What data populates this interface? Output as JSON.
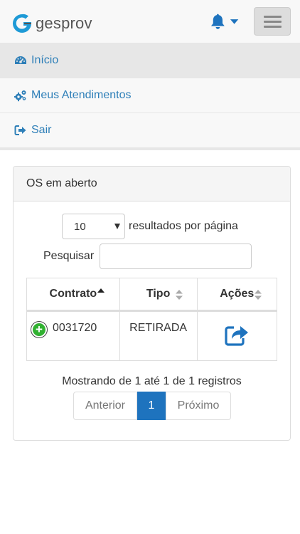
{
  "brand": {
    "logo_text": "gesprov",
    "accent": "#1e9ad6"
  },
  "header": {
    "bell_icon": "bell-icon",
    "menu_icon": "hamburger-icon"
  },
  "nav": {
    "items": [
      {
        "label": "Início",
        "icon": "dashboard-icon",
        "active": true
      },
      {
        "label": "Meus Atendimentos",
        "icon": "gears-icon",
        "active": false
      },
      {
        "label": "Sair",
        "icon": "sign-out-icon",
        "active": false
      }
    ]
  },
  "panel": {
    "title": "OS em aberto",
    "length_value": "10",
    "length_label": "resultados por página",
    "search_label": "Pesquisar",
    "search_value": "",
    "table": {
      "columns": [
        "Contrato",
        "Tipo",
        "Ações"
      ],
      "rows": [
        {
          "contrato": "0031720",
          "tipo": "RETIRADA",
          "acao_icon": "share-icon"
        }
      ]
    },
    "info": "Mostrando de 1 até 1 de 1 registros",
    "pagination": {
      "prev": "Anterior",
      "current": "1",
      "next": "Próximo"
    }
  },
  "colors": {
    "link": "#2e7fb8",
    "primary": "#1e73be",
    "success": "#31b131"
  }
}
